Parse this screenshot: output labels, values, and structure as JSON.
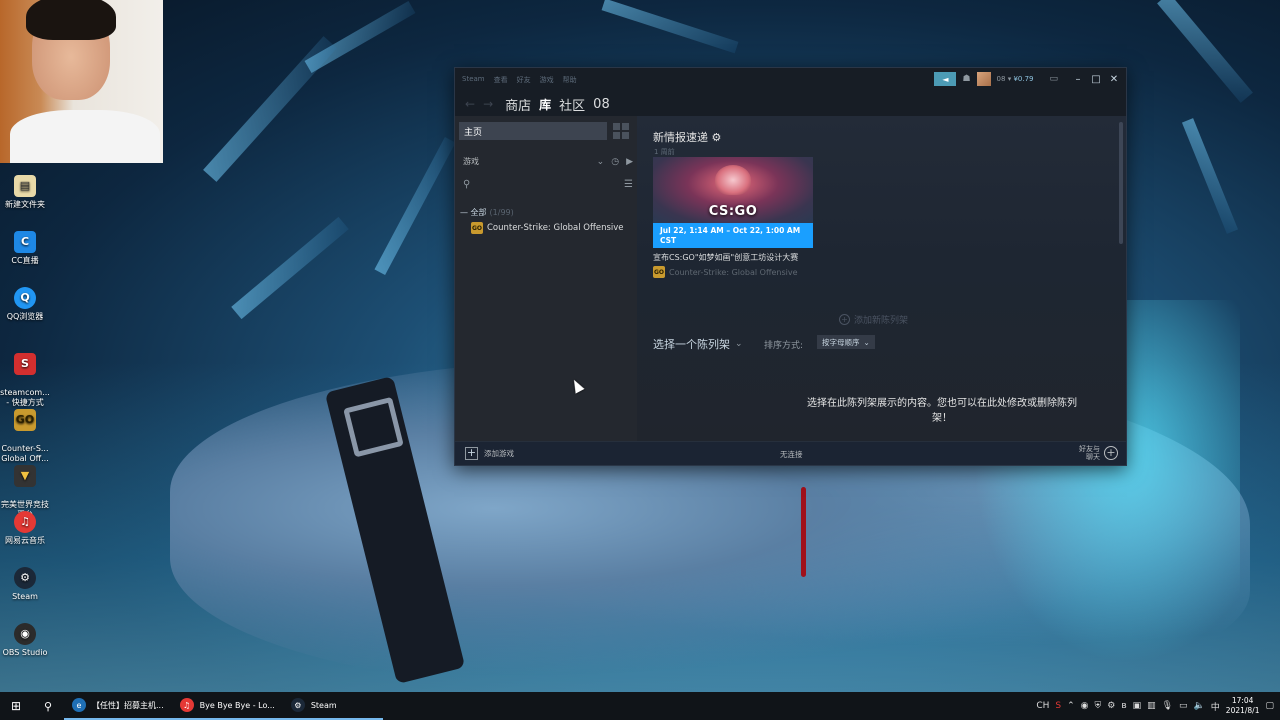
{
  "desktop": {
    "icons": [
      {
        "label": "新建文件夹",
        "icon": "document-icon",
        "color": "#e8d9a8"
      },
      {
        "label": "CC直播",
        "icon": "cc-live-icon",
        "color": "#1e88e5"
      },
      {
        "label": "QQ浏览器",
        "icon": "qq-browser-icon",
        "color": "#2196f3"
      },
      {
        "label": "steamcom...\n- 快捷方式",
        "icon": "steamcommunity-icon",
        "color": "#d32f2f"
      },
      {
        "label": "Counter-S...\nGlobal Off...",
        "icon": "csgo-icon",
        "color": "#c99a2e"
      },
      {
        "label": "完美世界竞技\n平台",
        "icon": "perfect-world-icon",
        "color": "#333333"
      },
      {
        "label": "网易云音乐",
        "icon": "netease-music-icon",
        "color": "#e53935"
      },
      {
        "label": "Steam",
        "icon": "steam-icon",
        "color": "#1b2838"
      },
      {
        "label": "OBS Studio",
        "icon": "obs-icon",
        "color": "#2b2b2b"
      }
    ]
  },
  "steam": {
    "menu": [
      "Steam",
      "查看",
      "好友",
      "游戏",
      "帮助"
    ],
    "account": {
      "name": "08",
      "balance": "¥0.79"
    },
    "window_controls": {
      "minimize": "–",
      "maximize": "□",
      "close": "✕"
    },
    "nav": {
      "back": "←",
      "forward": "→",
      "store": "商店",
      "library": "库",
      "community": "社区",
      "user": "08"
    },
    "sidebar": {
      "home": "主页",
      "games_label": "游戏",
      "all_label": "— 全部",
      "all_count": "(1/99)",
      "game_name": "Counter-Strike: Global Offensive",
      "game_icon_text": "GO"
    },
    "main": {
      "news_title": "新情报速递",
      "news_week": "1 周前",
      "news_card": {
        "logo": "CS:GO",
        "date": "Jul 22, 1:14 AM  – Oct 22, 1:00 AM CST",
        "headline": "宣布CS:GO\"如梦如画\"创意工坊设计大赛",
        "game": "Counter-Strike: Global Offensive"
      },
      "add_shelf": "添加新陈列架",
      "shelf_select": "选择一个陈列架",
      "sort_label": "排序方式:",
      "sort_value": "按字母顺序",
      "hint": "选择在此陈列架展示的内容。您也可以在此处修改或删除陈列架！"
    },
    "bottom": {
      "add_game": "添加游戏",
      "no_download": "无连接",
      "friends": "好友与\n聊天"
    }
  },
  "taskbar": {
    "apps": [
      {
        "label": "【任性】招募主机...",
        "icon": "edge-icon",
        "color": "#1f6fb5"
      },
      {
        "label": "Bye Bye Bye - Lo...",
        "icon": "netease-music-icon",
        "color": "#e53935"
      },
      {
        "label": "Steam",
        "icon": "steam-icon",
        "color": "#1b2838"
      }
    ],
    "tray": {
      "lang": "CH",
      "time": "17:04",
      "date": "2021/8/1"
    }
  }
}
